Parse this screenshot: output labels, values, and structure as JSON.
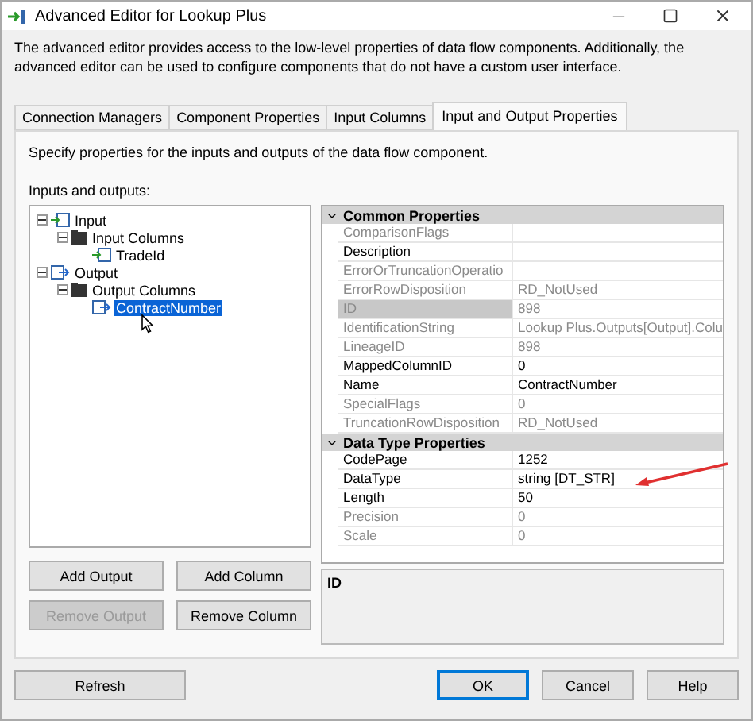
{
  "window": {
    "title": "Advanced Editor for Lookup Plus"
  },
  "description": "The advanced editor provides access to the low-level properties of data flow components. Additionally, the advanced editor can be used to configure components that do not have a custom user interface.",
  "tabs": [
    {
      "label": "Connection Managers",
      "selected": false
    },
    {
      "label": "Component Properties",
      "selected": false
    },
    {
      "label": "Input Columns",
      "selected": false
    },
    {
      "label": "Input and Output Properties",
      "selected": true
    }
  ],
  "panel": {
    "description": "Specify properties for the inputs and outputs of the data flow component.",
    "tree_label": "Inputs and outputs:"
  },
  "tree": [
    {
      "label": "Input",
      "kind": "input",
      "expanded": true,
      "selected": false,
      "children": [
        {
          "label": "Input Columns",
          "kind": "folder",
          "expanded": true,
          "selected": false,
          "children": [
            {
              "label": "TradeId",
              "kind": "input",
              "selected": false
            }
          ]
        }
      ]
    },
    {
      "label": "Output",
      "kind": "output",
      "expanded": true,
      "selected": false,
      "children": [
        {
          "label": "Output Columns",
          "kind": "folder",
          "expanded": true,
          "selected": false,
          "children": [
            {
              "label": "ContractNumber",
              "kind": "output",
              "selected": true
            }
          ]
        }
      ]
    }
  ],
  "property_grid": [
    {
      "category": "Common Properties",
      "expanded": true,
      "properties": [
        {
          "name": "ComparisonFlags",
          "readonly": true,
          "selected": false
        },
        {
          "name": "Description",
          "readonly": false,
          "selected": false
        },
        {
          "name": "ErrorOrTruncationOperatio",
          "readonly": true,
          "selected": false
        },
        {
          "name": "ErrorRowDisposition",
          "value": "RD_NotUsed",
          "readonly": true,
          "selected": false
        },
        {
          "name": "ID",
          "value": "898",
          "readonly": true,
          "selected": true
        },
        {
          "name": "IdentificationString",
          "value": "Lookup Plus.Outputs[Output].Colu",
          "readonly": true,
          "selected": false
        },
        {
          "name": "LineageID",
          "value": "898",
          "readonly": true,
          "selected": false
        },
        {
          "name": "MappedColumnID",
          "value": "0",
          "readonly": false,
          "selected": false
        },
        {
          "name": "Name",
          "value": "ContractNumber",
          "readonly": false,
          "selected": false
        },
        {
          "name": "SpecialFlags",
          "value": "0",
          "readonly": true,
          "selected": false
        },
        {
          "name": "TruncationRowDisposition",
          "value": "RD_NotUsed",
          "readonly": true,
          "selected": false
        }
      ]
    },
    {
      "category": "Data Type Properties",
      "expanded": true,
      "properties": [
        {
          "name": "CodePage",
          "value": "1252",
          "readonly": false,
          "selected": false
        },
        {
          "name": "DataType",
          "value": "string [DT_STR]",
          "readonly": false,
          "selected": false
        },
        {
          "name": "Length",
          "value": "50",
          "readonly": false,
          "selected": false
        },
        {
          "name": "Precision",
          "value": "0",
          "readonly": true,
          "selected": false
        },
        {
          "name": "Scale",
          "value": "0",
          "readonly": true,
          "selected": false
        }
      ]
    }
  ],
  "help_panel": {
    "title": "ID"
  },
  "buttons": [
    {
      "label": "Add Output",
      "disabled": false
    },
    {
      "label": "Add Column",
      "disabled": false
    },
    {
      "label": "Remove Output",
      "disabled": true
    },
    {
      "label": "Remove Column",
      "disabled": false
    }
  ],
  "footer_buttons": [
    {
      "label": "Refresh",
      "default": false
    },
    {
      "label": "OK",
      "default": true
    },
    {
      "label": "Cancel",
      "default": false
    },
    {
      "label": "Help",
      "default": false
    }
  ]
}
